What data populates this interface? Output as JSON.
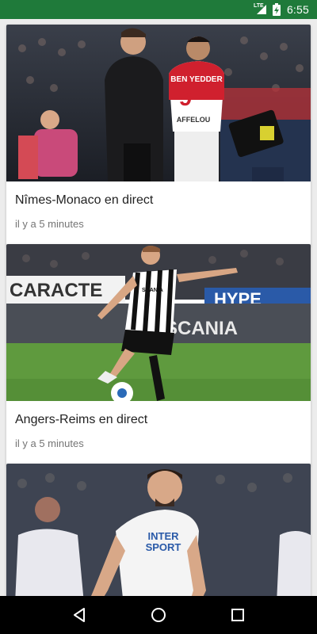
{
  "status_bar": {
    "network": "LTE",
    "time": "6:55",
    "icons": [
      "lte-icon",
      "signal-icon",
      "battery-charging-icon"
    ]
  },
  "articles": [
    {
      "title": "Nîmes-Monaco en direct",
      "time": "il y a 5 minutes",
      "image": "coach-and-monaco-player-photo"
    },
    {
      "title": "Angers-Reims en direct",
      "time": "il y a 5 minutes",
      "image": "angers-player-kicking-ball-photo"
    },
    {
      "title": "",
      "time": "",
      "image": "amiens-player-photo"
    }
  ],
  "image_text": {
    "jersey_name": "BEN YEDDER",
    "jersey_number": "9",
    "jersey_sponsor": "AFFELOU",
    "board_left": "CARACTE",
    "board_center": "SCANIA",
    "board_right": "HYPE",
    "shirt_brand": "SCANIA",
    "shirt_sponsor_line1": "INTER",
    "shirt_sponsor_line2": "SPORT"
  },
  "colors": {
    "status_bar": "#1f7a3a",
    "nav_bar": "#000000",
    "background": "#ececec",
    "card": "#ffffff",
    "title": "#222222",
    "meta": "#757575"
  },
  "nav_bar": {
    "buttons": [
      "back-icon",
      "home-icon",
      "recents-icon"
    ]
  }
}
